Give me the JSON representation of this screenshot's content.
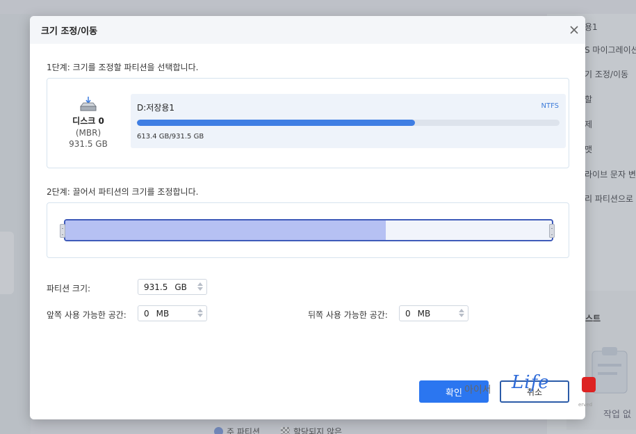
{
  "background": {
    "right_panel_items": [
      "용1",
      "S 마이그레이션",
      "기 조정/이동",
      "할",
      "제",
      "맷",
      "라이브 문자 변",
      "리 파티션으로"
    ],
    "task_title": "스트",
    "task_empty": "작업 없",
    "legend": {
      "primary_partition": "주 파티션",
      "unallocated": "할당되지 않은"
    }
  },
  "dialog": {
    "title": "크기 조정/이동",
    "step1_label": "1단계: 크기를 조정할 파티션을 선택합니다.",
    "disk": {
      "name": "디스크 0",
      "type": "(MBR)",
      "size": "931.5 GB"
    },
    "partition": {
      "name": "D:저장용1",
      "fs": "NTFS",
      "usage": "613.4 GB/931.5 GB",
      "used_fraction": 0.658
    },
    "step2_label": "2단계: 끌어서 파티션의 크기를 조정합니다.",
    "resize_fill_fraction": 0.658,
    "fields": {
      "partition_size": {
        "label": "파티션 크기:",
        "value": "931.5",
        "unit": "GB"
      },
      "before_space": {
        "label": "앞쪽 사용 가능한 공간:",
        "value": "0",
        "unit": "MB"
      },
      "after_space": {
        "label": "뒤쪽 사용 가능한 공간:",
        "value": "0",
        "unit": "MB"
      }
    },
    "ok_label": "확인",
    "cancel_label": "취소"
  },
  "watermark": {
    "text": "아이서",
    "life": "Life",
    "small": "erved"
  },
  "colors": {
    "accent": "#2b76f0",
    "fill": "#3f7ee3",
    "resize_fill": "#b6c1f3",
    "border": "#3e5ab9"
  }
}
